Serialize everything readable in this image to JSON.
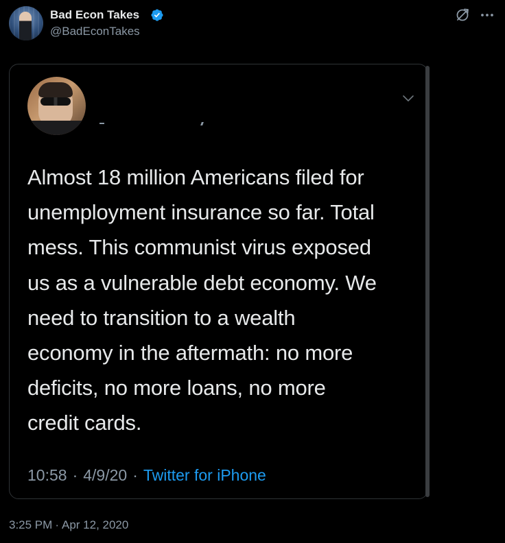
{
  "author": {
    "name": "Bad Econ Takes",
    "handle": "@BadEconTakes",
    "verified": true,
    "badge_color": "#1d9bf0"
  },
  "header_icons": [
    "translate-icon",
    "more-icon"
  ],
  "quoted_tweet": {
    "text": "Almost 18 million Americans filed for\nunemployment insurance so far. Total\nmess. This communist virus exposed\nus as a vulnerable debt economy. We\nneed to transition to a wealth\neconomy in the aftermath: no more\ndeficits, no more loans, no more\ncredit cards.",
    "time": "10:58",
    "separator": "·",
    "date": "4/9/20",
    "source": "Twitter for iPhone",
    "chevron_icon": "chevron-down-icon"
  },
  "post": {
    "time": "3:25 PM",
    "separator": "·",
    "date": "Apr 12, 2020"
  },
  "colors": {
    "background": "#000000",
    "text_primary": "#e7e9ea",
    "text_secondary": "#8b98a5",
    "link": "#1d9bf0",
    "border": "#2f3336"
  }
}
